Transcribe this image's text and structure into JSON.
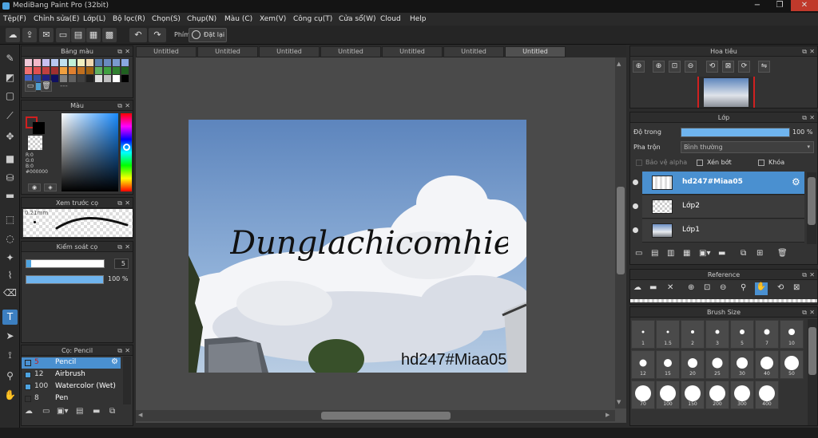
{
  "title": "MediBang Paint Pro (32bit)",
  "window_controls": [
    "−",
    "❐",
    "✕"
  ],
  "menu": [
    "Tệp(F)",
    "Chỉnh sửa(E)",
    "Lớp(L)",
    "Bộ lọc(R)",
    "Chọn(S)",
    "Chụp(N)",
    "Màu (C)",
    "Xem(V)",
    "Công cụ(T)",
    "Cửa sổ(W)",
    "Cloud",
    "Help"
  ],
  "toolbar": {
    "key_label": "Phím",
    "reset_label": "Đặt lại"
  },
  "tabs": [
    "Untitled",
    "Untitled",
    "Untitled",
    "Untitled",
    "Untitled",
    "Untitled",
    "Untitled"
  ],
  "palette_panel": {
    "title": "Bảng màu",
    "dashes": "---",
    "swatches": [
      "#f0c8d8",
      "#f4b8c8",
      "#c8c0f0",
      "#b8c8f0",
      "#c0e0f0",
      "#c0f0d8",
      "#f0f0c0",
      "#f0d8b0",
      "#5b7fb0",
      "#6a8ac0",
      "#7a9ad0",
      "#8aa8e0",
      "#f07070",
      "#e05050",
      "#c04040",
      "#a03030",
      "#f0a040",
      "#e08030",
      "#c07020",
      "#a06010",
      "#60b060",
      "#40a040",
      "#308030",
      "#206020",
      "#4060c0",
      "#3050a0",
      "#202080",
      "#101060",
      "#808080",
      "#606060",
      "#404040",
      "#202020",
      "#e0e0e0",
      "#c0c0c0",
      "#ffffff",
      "#000000",
      "#d05050",
      "#50a0d0"
    ]
  },
  "color_panel": {
    "title": "Màu",
    "r": "R:0",
    "g": "G:0",
    "b": "B:0",
    "hex": "#000000"
  },
  "preview_panel": {
    "title": "Xem trước cọ",
    "size": "0.21mm"
  },
  "control_panel": {
    "title": "Kiểm soát cọ",
    "size_value": "5",
    "opacity_value": "100 %",
    "opacity_fraction": 1.0
  },
  "brush_panel": {
    "title": "Cọ: Pencil",
    "items": [
      {
        "size": "5",
        "name": "Pencil",
        "color": "#4da3e0",
        "active": true
      },
      {
        "size": "12",
        "name": "Airbrush",
        "color": "#4da3e0",
        "active": false
      },
      {
        "size": "100",
        "name": "Watercolor (Wet)",
        "color": "#4da3e0",
        "active": false
      },
      {
        "size": "8",
        "name": "Pen",
        "color": "#333333",
        "active": false
      }
    ]
  },
  "navigator": {
    "title": "Hoa tiêu"
  },
  "layer_panel": {
    "title": "Lớp",
    "opacity_label": "Độ trong",
    "opacity_value": "100 %",
    "opacity_fraction": 1.0,
    "blend_label": "Pha trộn",
    "blend_value": "Bình thường",
    "protect_alpha": "Bảo vệ alpha",
    "clipping": "Xén bớt",
    "lock": "Khóa",
    "layers": [
      {
        "name": "hd247#Miaa05",
        "active": true
      },
      {
        "name": "Lớp2",
        "active": false
      },
      {
        "name": "Lớp1",
        "active": false
      }
    ]
  },
  "reference_panel": {
    "title": "Reference"
  },
  "brush_size_panel": {
    "title": "Brush Size",
    "sizes": [
      "1",
      "1.5",
      "2",
      "3",
      "5",
      "7",
      "10",
      "12",
      "15",
      "20",
      "25",
      "30",
      "40",
      "50",
      "70",
      "100",
      "150",
      "200",
      "300",
      "400"
    ]
  },
  "canvas": {
    "handwriting": "Dunglachicomhieudua",
    "watermark": "hd247#Miaa05"
  },
  "colors": {
    "accent": "#4a90d0",
    "fg": "#000000",
    "bg": "#ffffff"
  }
}
